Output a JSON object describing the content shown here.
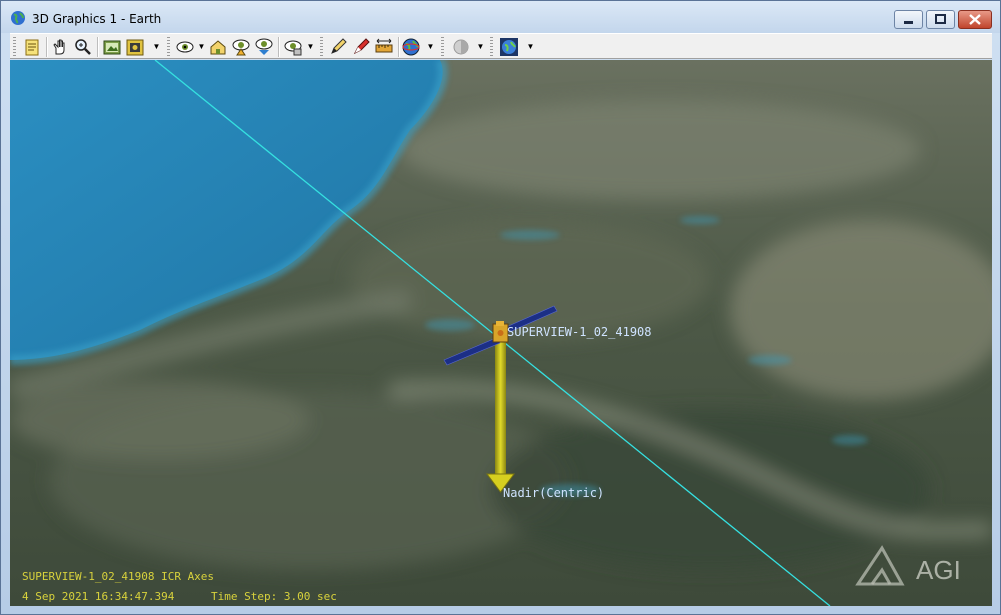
{
  "window": {
    "title": "3D Graphics 1 - Earth",
    "icon": "earth-globe-icon",
    "controls": [
      "minimize-icon",
      "maximize-icon",
      "close-icon"
    ]
  },
  "toolbar": {
    "buttons": [
      {
        "name": "properties-icon"
      },
      {
        "name": "pan-hand-icon"
      },
      {
        "name": "zoom-icon"
      },
      {
        "name": "snapshot-icon"
      },
      {
        "name": "record-movie-icon"
      },
      {
        "name": "view-from-to-icon"
      },
      {
        "name": "home-view-icon"
      },
      {
        "name": "orient-north-icon"
      },
      {
        "name": "orient-top-down-icon"
      },
      {
        "name": "view-options-icon"
      },
      {
        "name": "measure-pencil-icon"
      },
      {
        "name": "annotation-marker-icon"
      },
      {
        "name": "ruler-icon"
      },
      {
        "name": "globe-manager-icon"
      },
      {
        "name": "lighting-icon"
      },
      {
        "name": "terrain-globe-icon"
      }
    ]
  },
  "scene": {
    "satellite_label": "SUPERVIEW-1_02_41908",
    "vector_label": "Nadir(Centric)",
    "hud_axes": "SUPERVIEW-1_02_41908 ICR Axes",
    "hud_time": "4 Sep 2021 16:34:47.394",
    "hud_step": "Time Step: 3.00 sec",
    "logo_text": "AGI",
    "colors": {
      "orbit_line": "#35e0e0",
      "vector": "#c9c21a",
      "hud_text": "#d8d23c",
      "ocean": "#2a86b8"
    }
  }
}
